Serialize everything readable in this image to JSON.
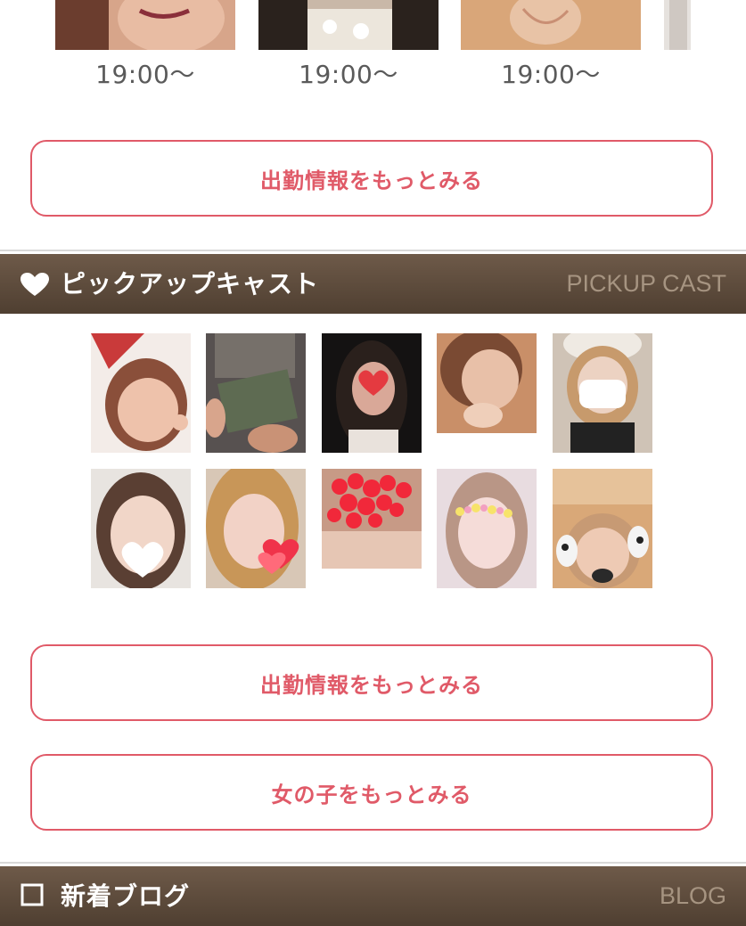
{
  "schedule": {
    "times": [
      "19:00〜",
      "19:00〜",
      "19:00〜"
    ]
  },
  "buttons": {
    "schedule_more_1": "出勤情報をもっとみる",
    "schedule_more_2": "出勤情報をもっとみる",
    "girls_more": "女の子をもっとみる"
  },
  "pickup": {
    "icon": "heart-icon",
    "title": "ピックアップキャスト",
    "subtitle": "PICKUP CAST",
    "cast_count": 10
  },
  "blog": {
    "icon": "square-icon",
    "title": "新着ブログ",
    "subtitle": "BLOG"
  },
  "colors": {
    "accent": "#e05a68",
    "header_bg": "#5c4a3b",
    "header_sub": "#a69481",
    "time_text": "#5a5a5a"
  }
}
